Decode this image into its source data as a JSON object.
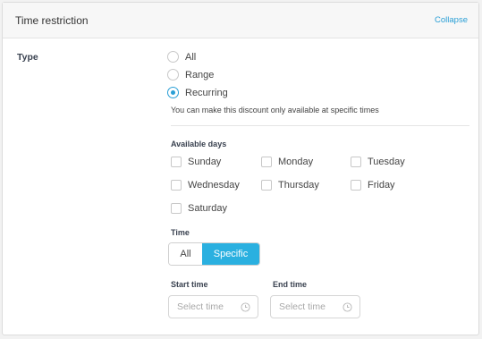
{
  "header": {
    "title": "Time restriction",
    "collapse": "Collapse"
  },
  "type_label": "Type",
  "type_options": [
    {
      "label": "All",
      "checked": false
    },
    {
      "label": "Range",
      "checked": false
    },
    {
      "label": "Recurring",
      "checked": true
    }
  ],
  "hint": "You can make this discount only available at specific times",
  "available_days": {
    "label": "Available days",
    "days": [
      "Sunday",
      "Monday",
      "Tuesday",
      "Wednesday",
      "Thursday",
      "Friday",
      "Saturday"
    ]
  },
  "time": {
    "label": "Time",
    "options": [
      "All",
      "Specific"
    ],
    "selected": "Specific"
  },
  "start_time": {
    "label": "Start time",
    "placeholder": "Select time"
  },
  "end_time": {
    "label": "End time",
    "placeholder": "Select time"
  },
  "colors": {
    "accent": "#2ab0e0",
    "link": "#2a9fd6"
  }
}
